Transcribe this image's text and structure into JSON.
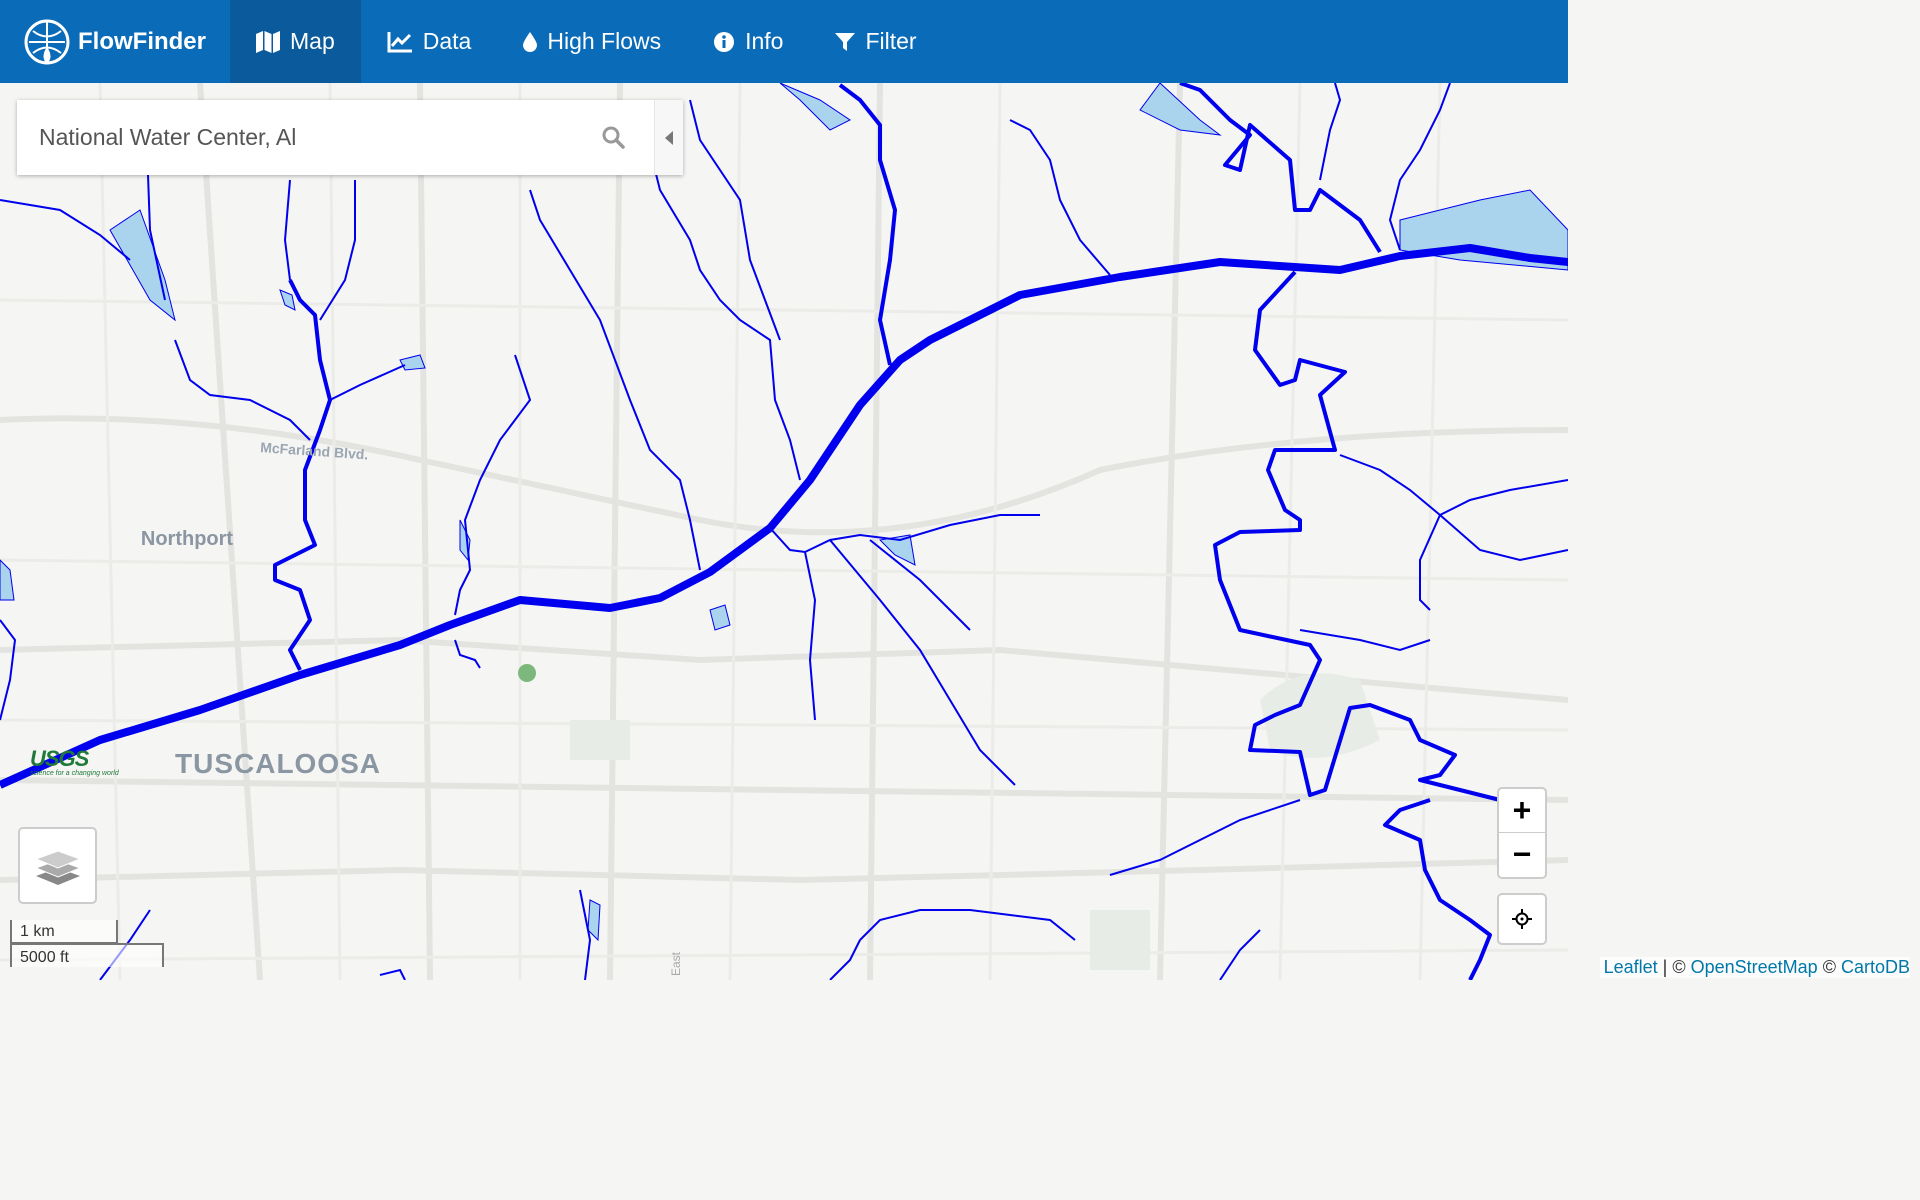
{
  "app": {
    "name": "FlowFinder"
  },
  "nav": [
    {
      "label": "Map",
      "icon": "map-icon",
      "active": true
    },
    {
      "label": "Data",
      "icon": "chart-icon",
      "active": false
    },
    {
      "label": "High Flows",
      "icon": "drop-icon",
      "active": false
    },
    {
      "label": "Info",
      "icon": "info-icon",
      "active": false
    },
    {
      "label": "Filter",
      "icon": "filter-icon",
      "active": false
    }
  ],
  "search": {
    "value": "National Water Center, Al"
  },
  "map": {
    "labels": {
      "northport": "Northport",
      "tuscaloosa": "TUSCALOOSA",
      "mcfarland": "McFarland Blvd.",
      "street": "East"
    },
    "scale": {
      "km": "1 km",
      "ft": "5000 ft"
    },
    "zoom": {
      "in": "+",
      "out": "−"
    },
    "river_color": "#0000ee",
    "marker_color": "#7cb87c"
  },
  "attribution": {
    "leaflet": "Leaflet",
    "sep1": " | © ",
    "osm": "OpenStreetMap",
    "sep2": " © ",
    "carto": "CartoDB"
  },
  "usgs": {
    "text": "USGS",
    "tagline": "science for a changing world"
  }
}
